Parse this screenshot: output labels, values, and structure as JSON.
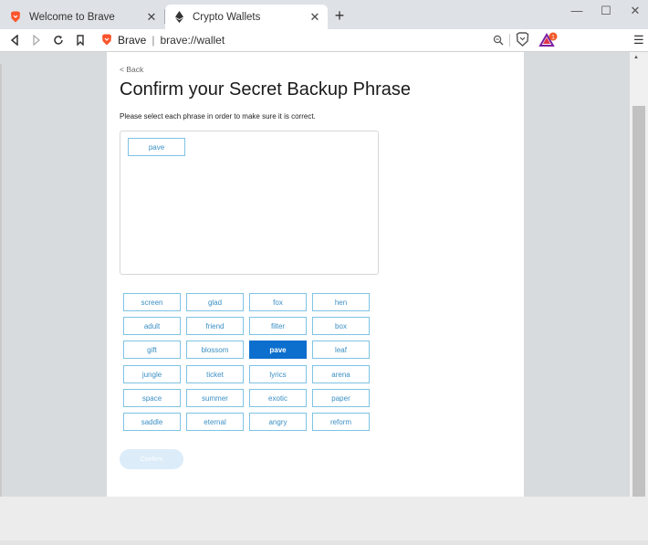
{
  "browser": {
    "tabs": [
      {
        "title": "Welcome to Brave",
        "active": false
      },
      {
        "title": "Crypto Wallets",
        "active": true
      }
    ],
    "address": {
      "brand": "Brave",
      "url": "brave://wallet"
    },
    "rewards_badge": "1"
  },
  "page": {
    "back_label": "< Back",
    "heading": "Confirm your Secret Backup Phrase",
    "subtitle": "Please select each phrase in order to make sure it is correct.",
    "selected_phrases": [
      "pave"
    ],
    "words": [
      "screen",
      "glad",
      "fox",
      "hen",
      "adult",
      "friend",
      "filter",
      "box",
      "gift",
      "blossom",
      "pave",
      "leaf",
      "jungle",
      "ticket",
      "lyrics",
      "arena",
      "space",
      "summer",
      "exotic",
      "paper",
      "saddle",
      "eternal",
      "angry",
      "reform"
    ],
    "selected_word_index": 10,
    "confirm_label": "Confirm"
  },
  "colors": {
    "accent": "#0c6fcd",
    "chip_border": "#7ec3e4",
    "chip_text": "#3b8fc4",
    "confirm_disabled": "#dcecf8"
  }
}
